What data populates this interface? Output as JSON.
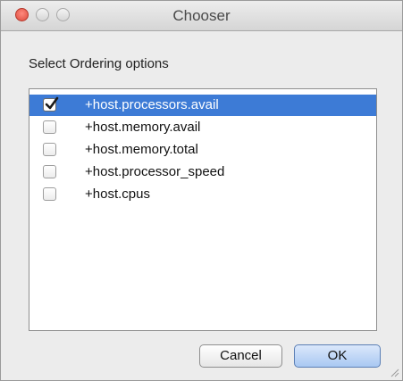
{
  "window": {
    "title": "Chooser",
    "prompt": "Select Ordering options"
  },
  "options": [
    {
      "label": "+host.processors.avail",
      "checked": true,
      "selected": true
    },
    {
      "label": "+host.memory.avail",
      "checked": false,
      "selected": false
    },
    {
      "label": "+host.memory.total",
      "checked": false,
      "selected": false
    },
    {
      "label": "+host.processor_speed",
      "checked": false,
      "selected": false
    },
    {
      "label": "+host.cpus",
      "checked": false,
      "selected": false
    }
  ],
  "buttons": {
    "cancel_label": "Cancel",
    "ok_label": "OK"
  },
  "colors": {
    "selection": "#3d7bd6",
    "close_button": "#dc4b3d"
  }
}
